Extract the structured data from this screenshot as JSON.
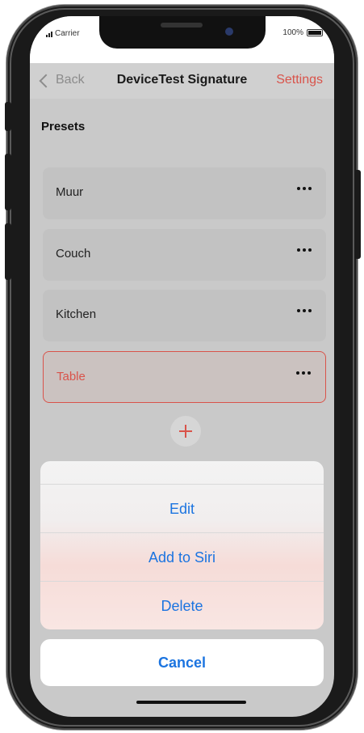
{
  "status_bar": {
    "carrier": "Carrier",
    "battery": "100%"
  },
  "nav": {
    "back_label": "Back",
    "title": "DeviceTest Signature",
    "settings_label": "Settings"
  },
  "presets": {
    "title": "Presets",
    "items": [
      {
        "label": "Muur"
      },
      {
        "label": "Couch"
      },
      {
        "label": "Kitchen"
      },
      {
        "label": "Table"
      }
    ],
    "selected_index": 3
  },
  "action_sheet": {
    "options": [
      {
        "label": "Edit"
      },
      {
        "label": "Add to Siri"
      },
      {
        "label": "Delete"
      }
    ],
    "cancel_label": "Cancel"
  },
  "colors": {
    "accent": "#d9534a",
    "link": "#1b74e0"
  },
  "icons": [
    "back-chevron-icon",
    "more-icon",
    "plus-icon",
    "signal-icon",
    "battery-icon"
  ]
}
